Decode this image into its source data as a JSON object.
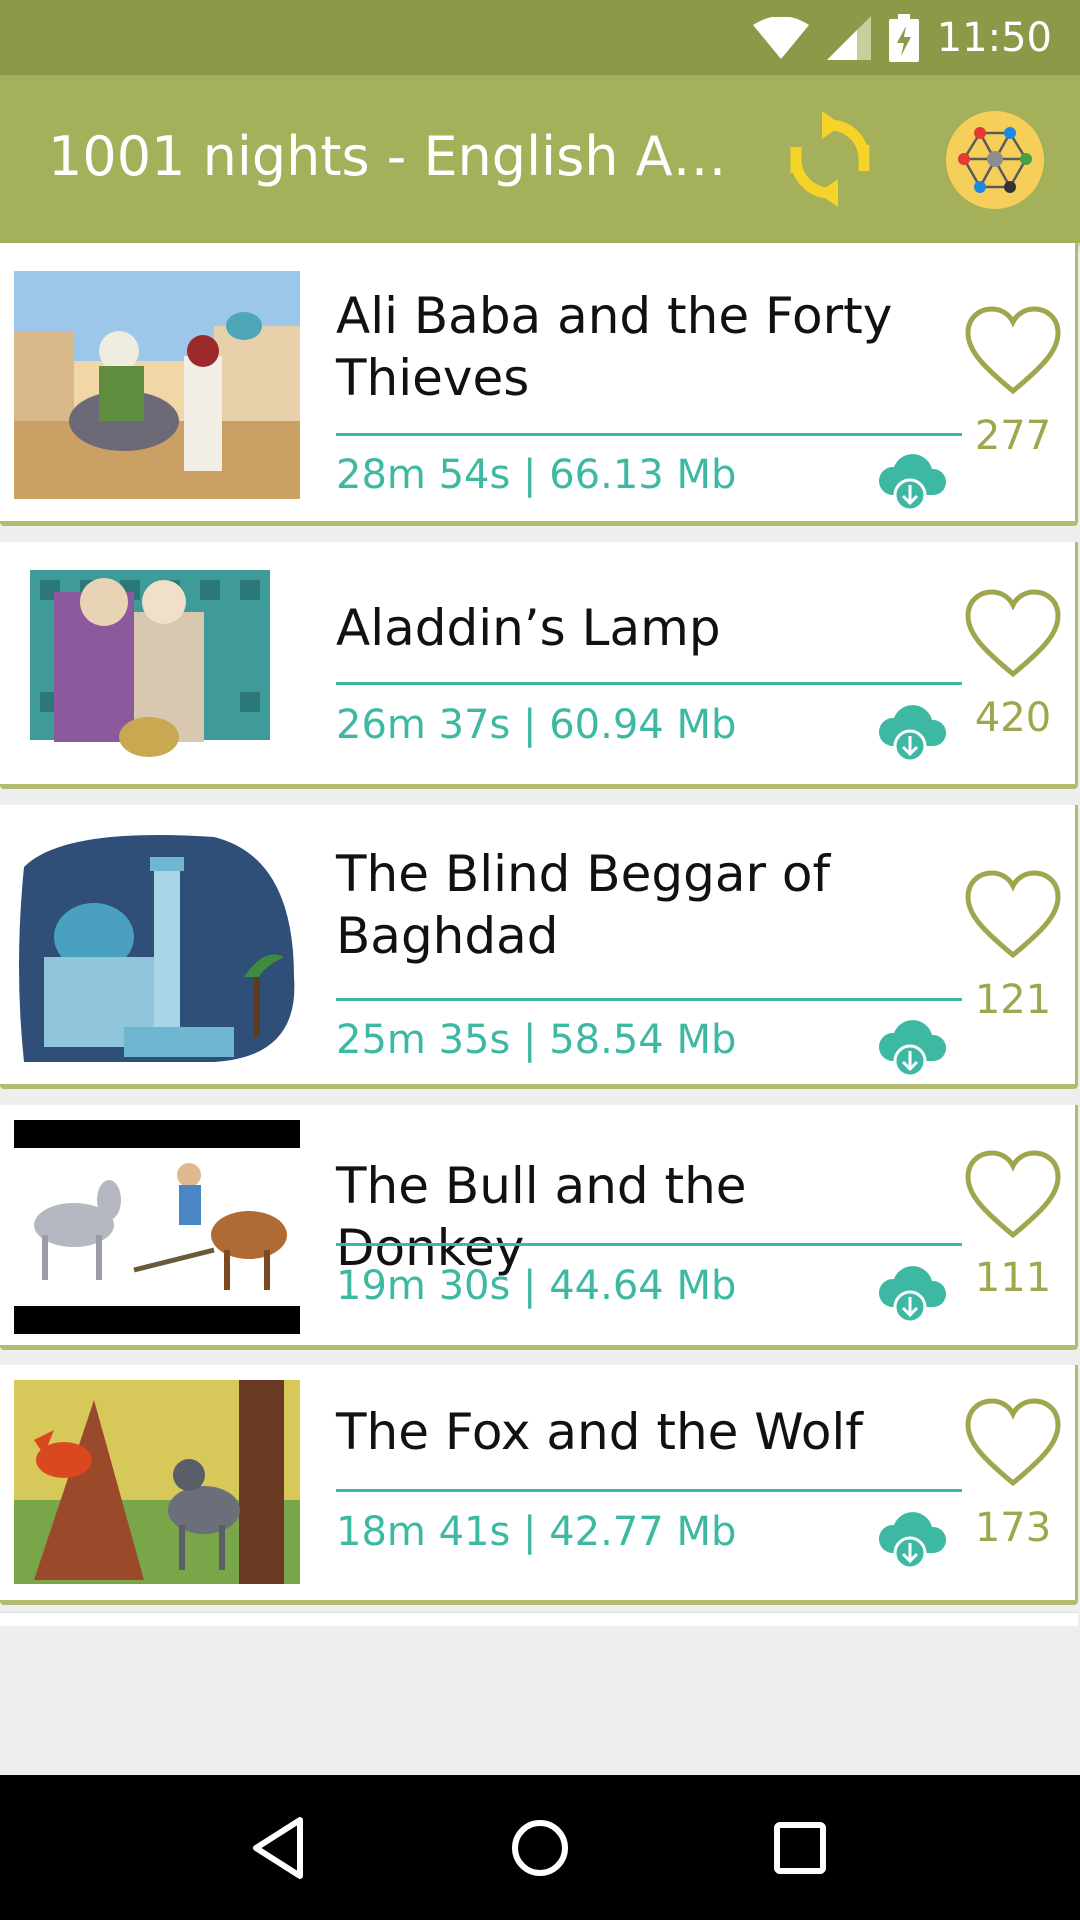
{
  "status": {
    "time": "11:50"
  },
  "app": {
    "title": "1001 nights - English A…"
  },
  "colors": {
    "accent": "#3cb8a3",
    "header": "#a4b05a",
    "status": "#8a9a48",
    "heart": "#9fa64d"
  },
  "stories": [
    {
      "title": "Ali Baba and the Forty Thieves",
      "meta": "28m 54s | 66.13 Mb",
      "likes": "277"
    },
    {
      "title": "Aladdin’s Lamp",
      "meta": "26m 37s | 60.94 Mb",
      "likes": "420"
    },
    {
      "title": "The Blind Beggar of Baghdad",
      "meta": "25m 35s | 58.54 Mb",
      "likes": "121"
    },
    {
      "title": "The Bull and the Donkey",
      "meta": "19m 30s | 44.64 Mb",
      "likes": "111"
    },
    {
      "title": "The Fox and the Wolf",
      "meta": "18m 41s | 42.77 Mb",
      "likes": "173"
    }
  ]
}
